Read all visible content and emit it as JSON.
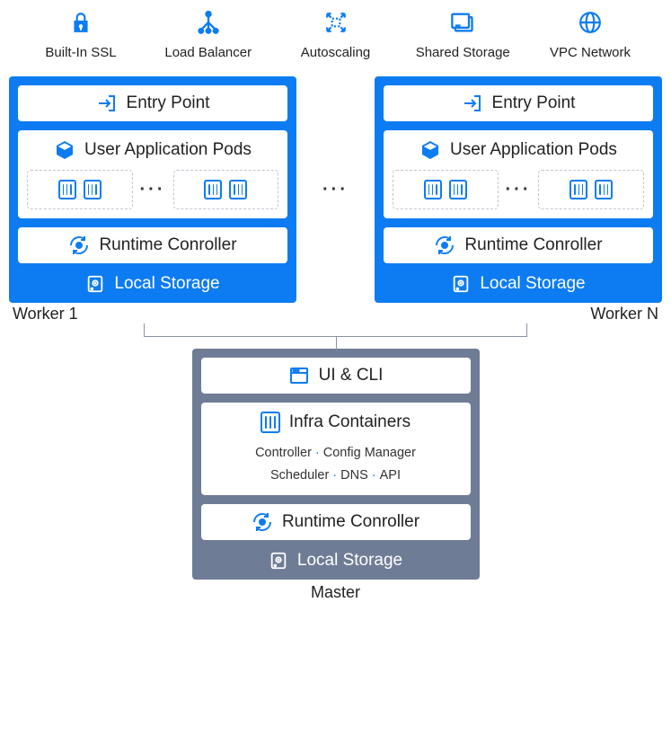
{
  "features": [
    {
      "label": "Built-In SSL"
    },
    {
      "label": "Load Balancer"
    },
    {
      "label": "Autoscaling"
    },
    {
      "label": "Shared Storage"
    },
    {
      "label": "VPC Network"
    }
  ],
  "worker": {
    "entry_point": "Entry Point",
    "user_pods": "User Application Pods",
    "pods_ellipsis": "···",
    "runtime": "Runtime Conroller",
    "storage": "Local Storage"
  },
  "worker_left_label": "Worker 1",
  "worker_right_label": "Worker N",
  "workers_ellipsis": "···",
  "master": {
    "ui_cli": "UI & CLI",
    "infra_title": "Infra Containers",
    "infra_items": [
      "Controller",
      "Config Manager",
      "Scheduler",
      "DNS",
      "API"
    ],
    "runtime": "Runtime Conroller",
    "storage": "Local Storage"
  },
  "master_label": "Master"
}
